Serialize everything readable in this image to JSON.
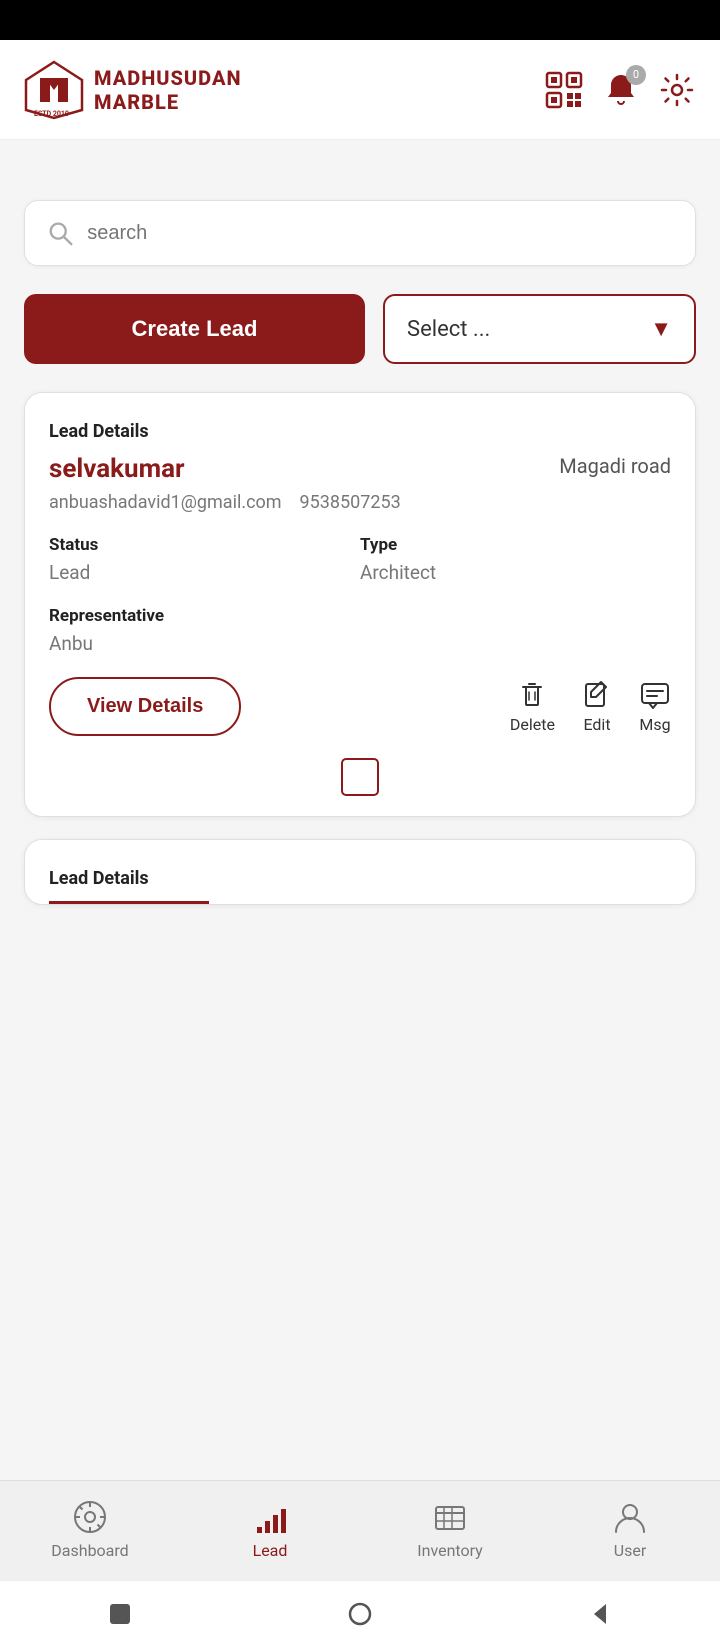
{
  "statusBar": {},
  "header": {
    "brandName": "MADHUSUDAN",
    "brandSub": "MARBLE",
    "notificationCount": "0"
  },
  "search": {
    "placeholder": "search"
  },
  "actions": {
    "createLeadLabel": "Create Lead",
    "selectPlaceholder": "Select ..."
  },
  "leadCard1": {
    "sectionLabel": "Lead Details",
    "name": "selvakumar",
    "location": "Magadi road",
    "email": "anbuashadavid1@gmail.com",
    "phone": "9538507253",
    "statusLabel": "Status",
    "statusValue": "Lead",
    "typeLabel": "Type",
    "typeValue": "Architect",
    "repLabel": "Representative",
    "repValue": "Anbu",
    "viewDetailsLabel": "View Details",
    "deleteLabel": "Delete",
    "editLabel": "Edit",
    "msgLabel": "Msg"
  },
  "leadCard2": {
    "sectionLabel": "Lead Details"
  },
  "bottomNav": {
    "items": [
      {
        "id": "dashboard",
        "label": "Dashboard",
        "active": false
      },
      {
        "id": "lead",
        "label": "Lead",
        "active": true
      },
      {
        "id": "inventory",
        "label": "Inventory",
        "active": false
      },
      {
        "id": "user",
        "label": "User",
        "active": false
      }
    ]
  }
}
